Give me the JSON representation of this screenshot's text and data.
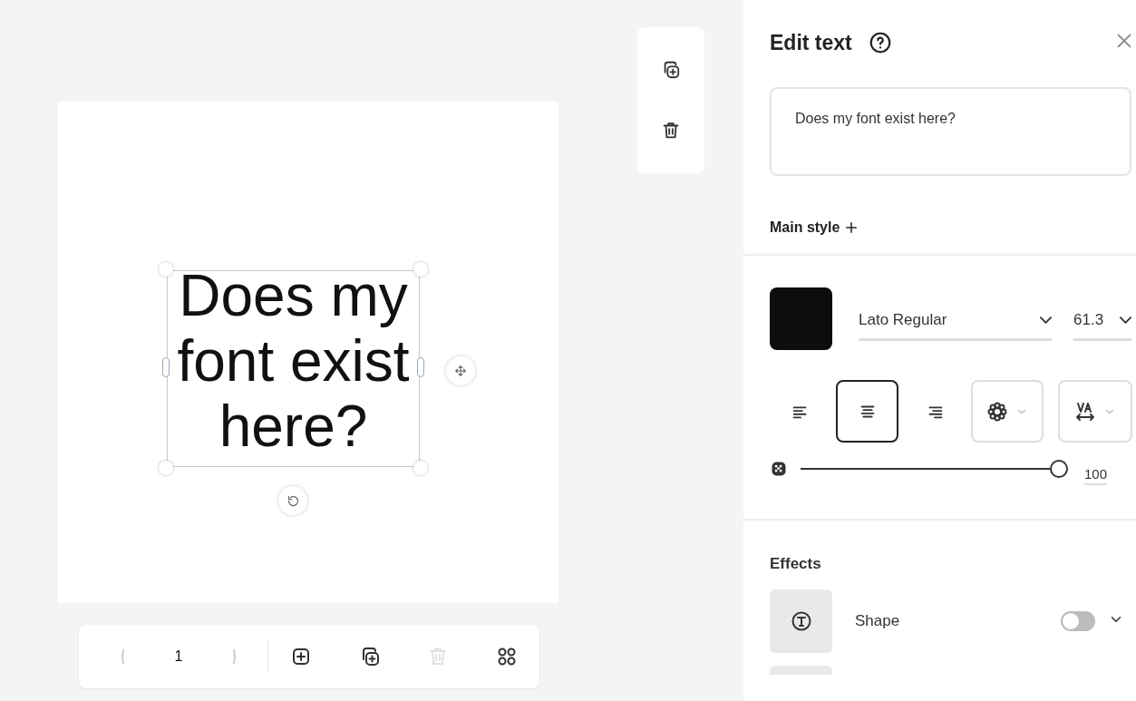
{
  "canvas": {
    "text": "Does my font exist here?"
  },
  "pager": {
    "page": "1",
    "prev_disabled": true,
    "next_disabled": true,
    "tools": [
      {
        "kind": "add",
        "disabled": false
      },
      {
        "kind": "duplicate",
        "disabled": false
      },
      {
        "kind": "delete",
        "disabled": true
      },
      {
        "kind": "grid",
        "disabled": false
      }
    ]
  },
  "panel": {
    "title": "Edit text",
    "text_value": "Does my font exist here?",
    "main_style": "Main style",
    "font": "Lato Regular",
    "size": "61.3",
    "alignments": [
      {
        "kind": "left",
        "selected": false
      },
      {
        "kind": "center",
        "selected": true
      },
      {
        "kind": "right",
        "selected": false
      }
    ],
    "opacity": {
      "level": 1,
      "reading": "100"
    },
    "effects_title": "Effects",
    "effects": [
      {
        "name": "Shape",
        "on": false
      }
    ]
  }
}
